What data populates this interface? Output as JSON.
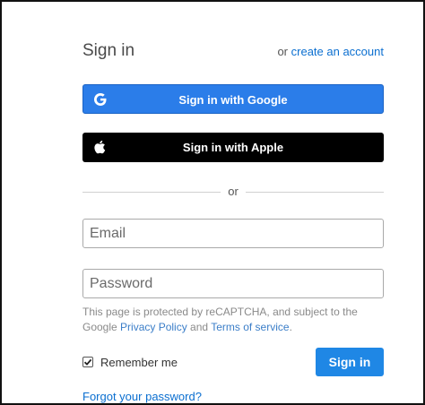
{
  "header": {
    "title": "Sign in",
    "or_text": "or",
    "create_link": "create an account"
  },
  "buttons": {
    "google_label": "Sign in with Google",
    "apple_label": "Sign in with Apple",
    "signin_label": "Sign in"
  },
  "divider": {
    "text": "or"
  },
  "form": {
    "email_placeholder": "Email",
    "password_placeholder": "Password"
  },
  "notice": {
    "prefix": "This page is protected by reCAPTCHA, and subject to the Google ",
    "privacy_link": "Privacy Policy",
    "and": " and ",
    "terms_link": "Terms of service",
    "suffix": "."
  },
  "remember": {
    "label": "Remember me",
    "checked": true
  },
  "forgot_link": "Forgot your password?",
  "colors": {
    "google_button": "#2b7de9",
    "apple_button": "#000000",
    "primary": "#1f87e5",
    "link": "#0b6fd0"
  },
  "icons": {
    "google": "google-g-icon",
    "apple": "apple-logo-icon",
    "check": "checkmark-icon"
  }
}
